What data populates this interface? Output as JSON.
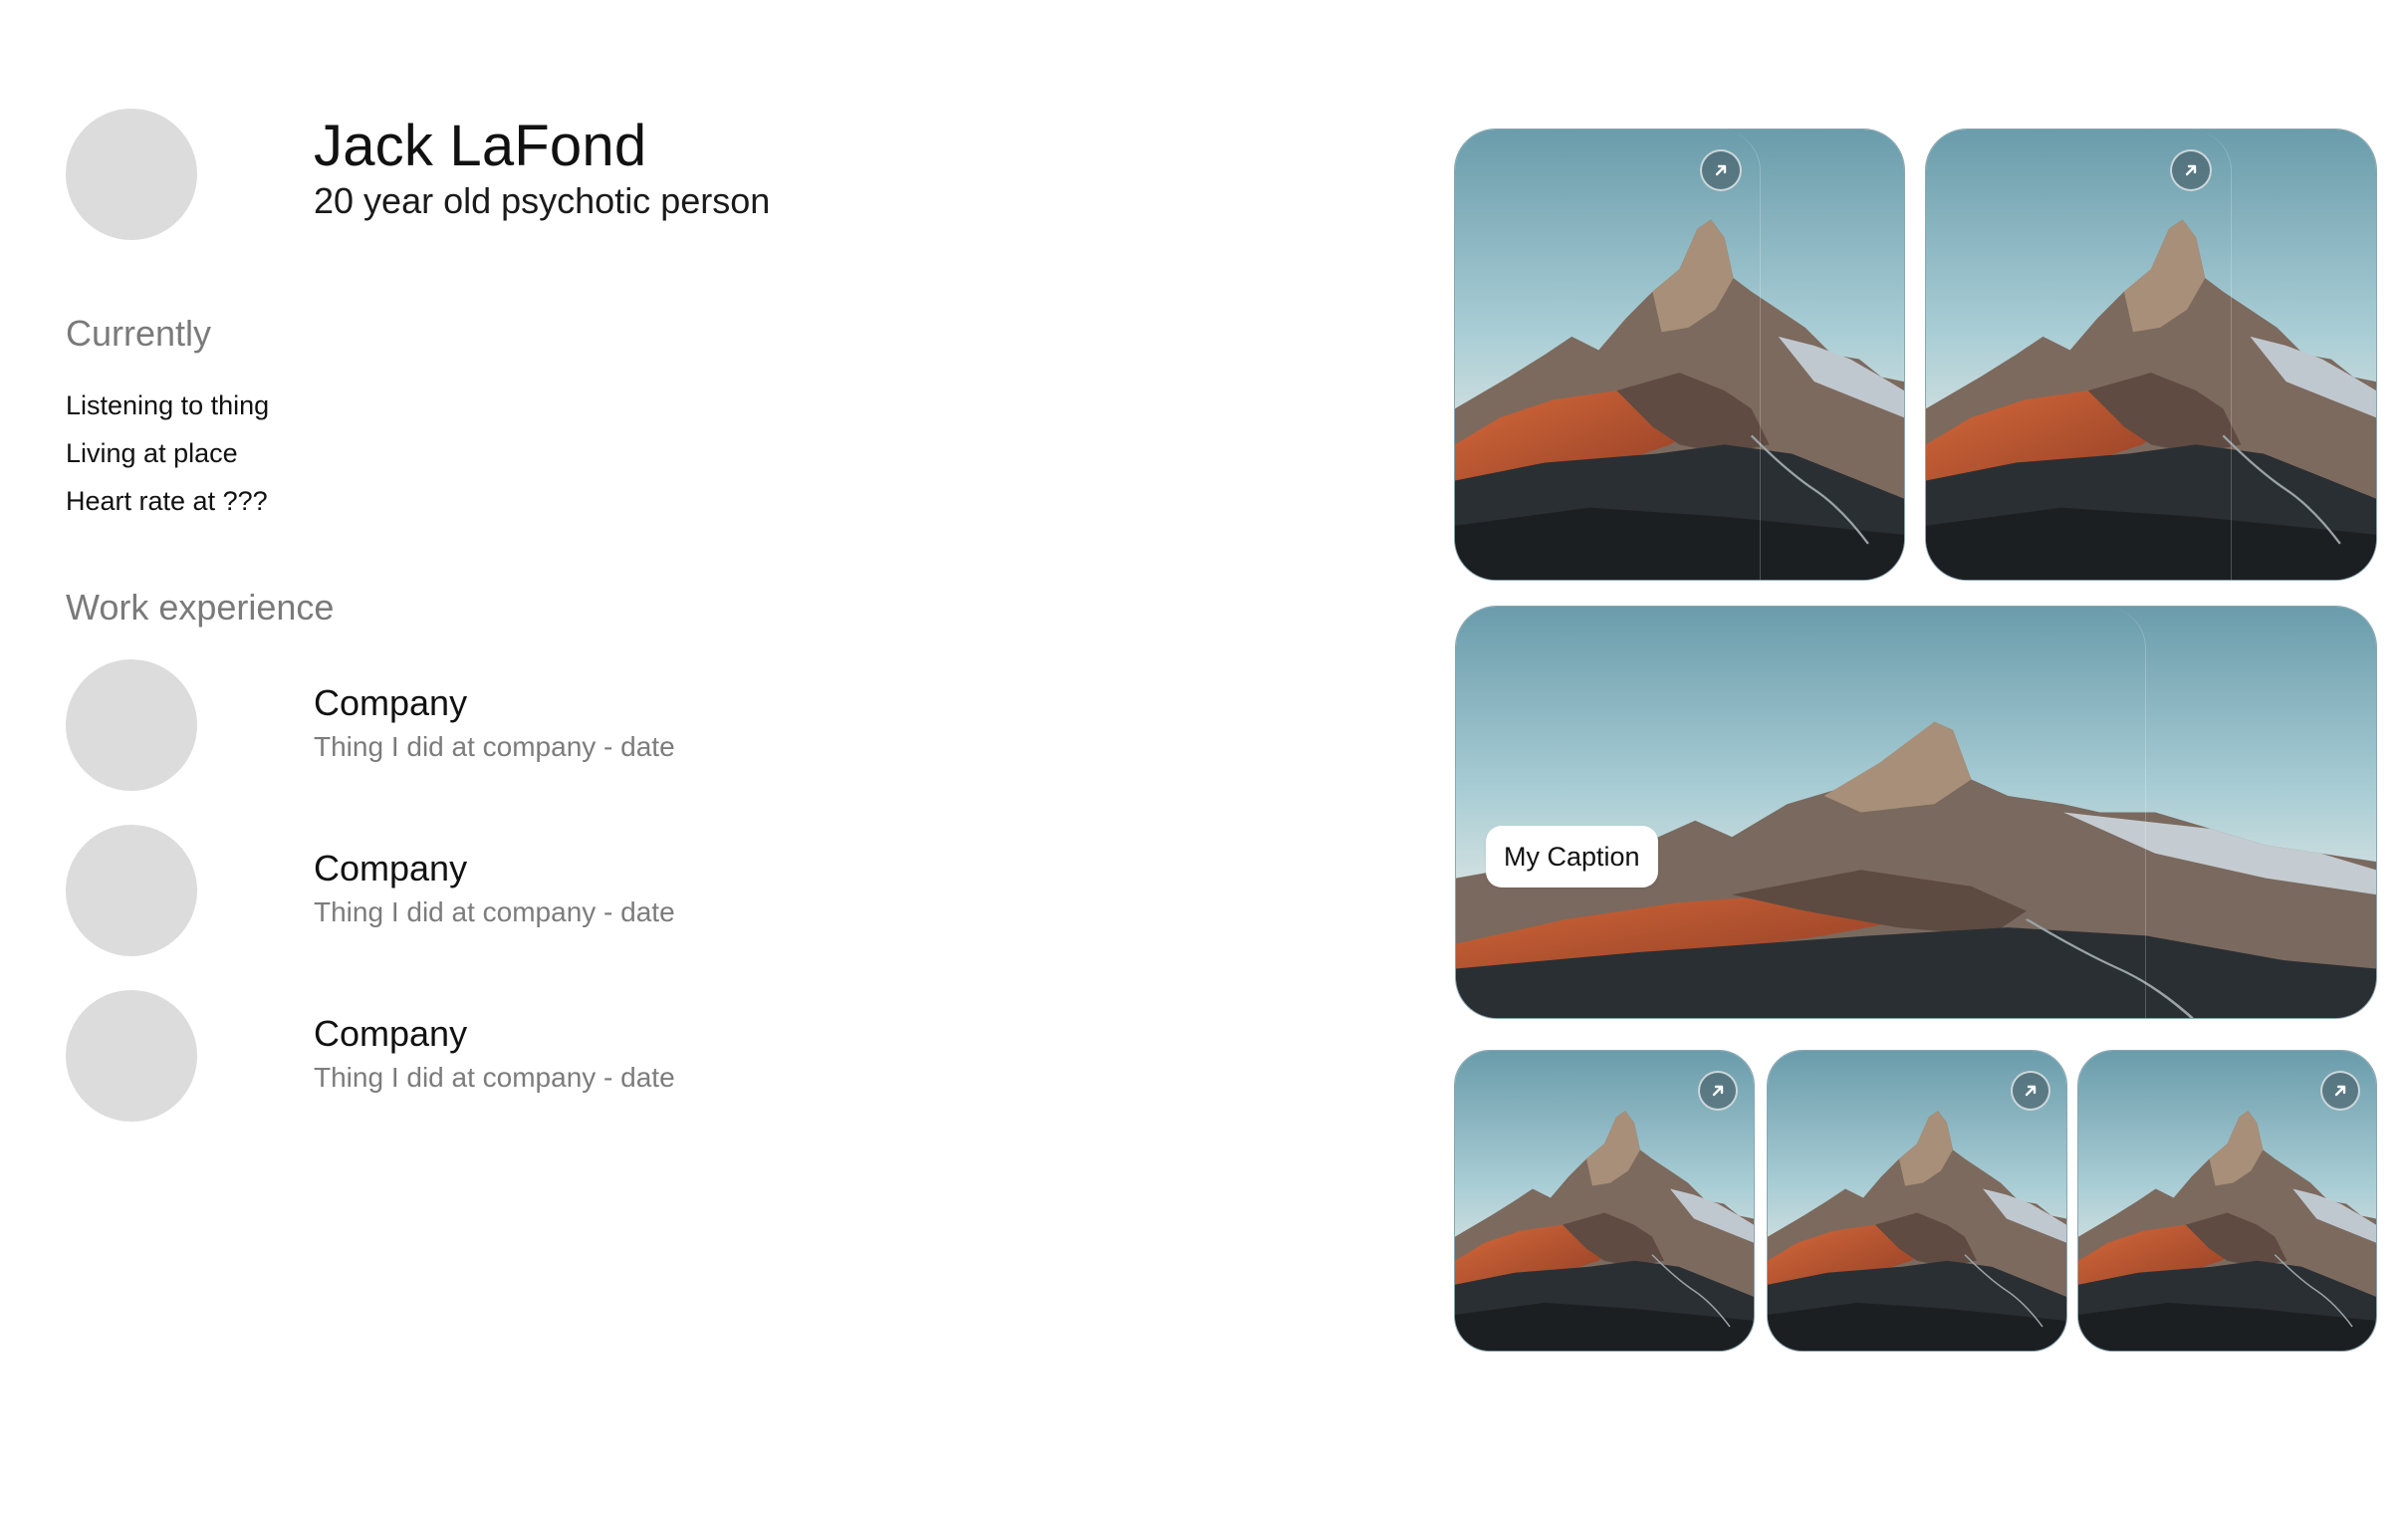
{
  "profile": {
    "name": "Jack LaFond",
    "tagline": "20 year old psychotic person"
  },
  "currently": {
    "title": "Currently",
    "items": [
      "Listening to thing",
      "Living at place",
      "Heart rate at ???"
    ]
  },
  "work": {
    "title": "Work experience",
    "items": [
      {
        "company": "Company",
        "role": "Thing I did at company - date"
      },
      {
        "company": "Company",
        "role": "Thing I did at company - date"
      },
      {
        "company": "Company",
        "role": "Thing I did at company - date"
      }
    ]
  },
  "gallery": {
    "caption": "My Caption",
    "icons": {
      "open": "arrow-up-right-icon"
    },
    "colors": {
      "sky_top": "#6fa0ae",
      "sky_bottom": "#c9dde0",
      "mountain_lit": "#c4552e",
      "ground": "#1f2326"
    }
  }
}
